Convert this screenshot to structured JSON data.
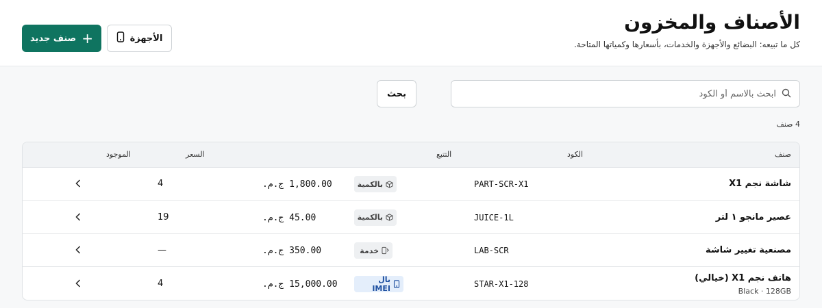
{
  "header": {
    "title": "الأصناف والمخزون",
    "subtitle": "كل ما تبيعه: البضائع والأجهزة والخدمات، بأسعارها وكمياتها المتاحة.",
    "new_item_label": "صنف جديد",
    "devices_label": "الأجهزة"
  },
  "search": {
    "placeholder": "ابحث بالاسم أو الكود",
    "value": "",
    "button_label": "بحث"
  },
  "count_label": "4 صنف",
  "table": {
    "columns": {
      "item": "صنف",
      "code": "الكود",
      "tracking": "التتبع",
      "price": "السعر",
      "stock": "الموجود"
    },
    "rows": [
      {
        "name": "شاشة نجم X1",
        "detail": "",
        "code": "PART-SCR-X1",
        "tracking": "بالكمية",
        "tracking_type": "quantity",
        "price": "1,800.00 ج.م.",
        "stock": "4"
      },
      {
        "name": "عصير مانجو ١ لتر",
        "detail": "",
        "code": "JUICE-1L",
        "tracking": "بالكمية",
        "tracking_type": "quantity",
        "price": "45.00 ج.م.",
        "stock": "19"
      },
      {
        "name": "مصنعية تغيير شاشة",
        "detail": "",
        "code": "LAB-SCR",
        "tracking": "خدمة",
        "tracking_type": "service",
        "price": "350.00 ج.م.",
        "stock": "—"
      },
      {
        "name": "هاتف نجم X1 (خيالي)",
        "detail": "Black · 128GB",
        "code": "STAR-X1-128",
        "tracking": "بال IMEI",
        "tracking_type": "imei",
        "price": "15,000.00 ج.م.",
        "stock": "4"
      }
    ]
  },
  "colors": {
    "primary": "#0f7460",
    "imei_badge": "#e4eefb",
    "neutral_badge": "#eef0f2"
  }
}
